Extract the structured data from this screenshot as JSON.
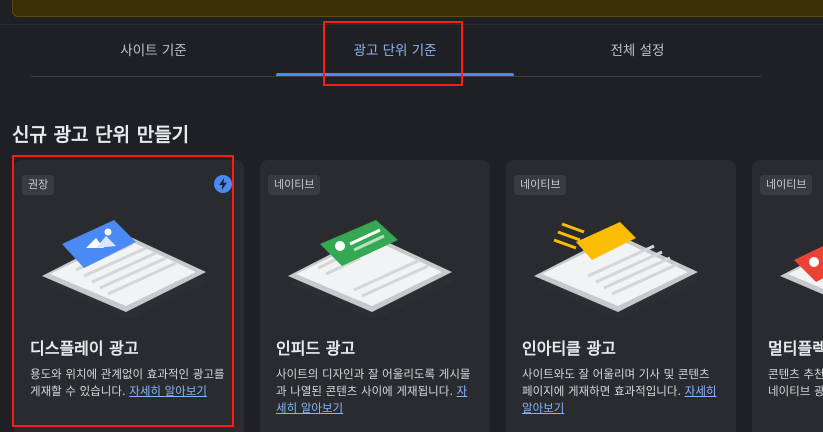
{
  "tabs": [
    {
      "label": "사이트 기준"
    },
    {
      "label": "광고 단위 기준"
    },
    {
      "label": "전체 설정"
    }
  ],
  "section_title": "신규 광고 단위 만들기",
  "cards": [
    {
      "badge": "권장",
      "title": "디스플레이 광고",
      "desc": "용도와 위치에 관계없이 효과적인 광고를 게재할 수 있습니다. ",
      "link": "자세히 알아보기"
    },
    {
      "badge": "네이티브",
      "title": "인피드 광고",
      "desc": "사이트의 디자인과 잘 어울리도록 게시물과 나열된 콘텐츠 사이에 게재됩니다. ",
      "link": "자세히 알아보기"
    },
    {
      "badge": "네이티브",
      "title": "인아티클 광고",
      "desc": "사이트와도 잘 어울리며 기사 및 콘텐츠 페이지에 게재하면 효과적입니다. ",
      "link": "자세히 알아보기"
    },
    {
      "badge": "네이티브",
      "title": "멀티플렉스",
      "desc": "콘텐츠 추천 형식으로 광고를 보여주는 네이티브 광고 단위입니다. ",
      "link": ""
    }
  ],
  "colors": {
    "accent": "#8ab4f8",
    "highlight": "#ff1a1a",
    "background": "#1f2023"
  }
}
